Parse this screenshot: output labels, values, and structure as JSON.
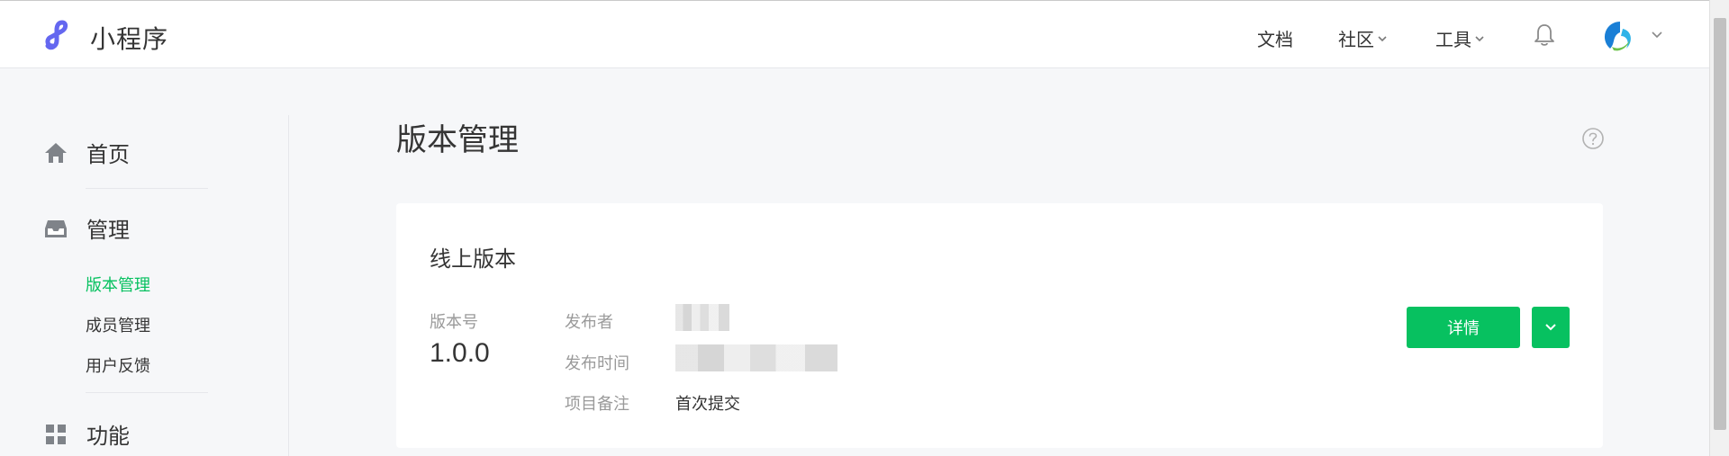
{
  "header": {
    "brand": "小程序",
    "nav": {
      "docs": "文档",
      "community": "社区",
      "tools": "工具"
    },
    "icons": {
      "logo": "mini-program-logo-icon",
      "bell": "bell-icon",
      "avatar": "avatar",
      "chevron": "chevron-down-icon"
    }
  },
  "sidebar": {
    "groups": [
      {
        "label": "首页",
        "icon": "home-icon"
      },
      {
        "label": "管理",
        "icon": "inbox-icon"
      },
      {
        "label": "功能",
        "icon": "grid-icon"
      }
    ],
    "manage_items": [
      {
        "label": "版本管理",
        "active": true
      },
      {
        "label": "成员管理",
        "active": false
      },
      {
        "label": "用户反馈",
        "active": false
      }
    ]
  },
  "main": {
    "title": "版本管理",
    "help_icon": "help-circle-icon",
    "online_version": {
      "title": "线上版本",
      "version_label": "版本号",
      "version_value": "1.0.0",
      "publisher_label": "发布者",
      "publish_time_label": "发布时间",
      "remark_label": "项目备注",
      "remark_value": "首次提交",
      "detail_button": "详情"
    }
  },
  "colors": {
    "accent": "#07c160",
    "text": "#353535",
    "muted": "#9a9a9a",
    "background": "#f6f7f9",
    "logo": "#6467f0"
  }
}
